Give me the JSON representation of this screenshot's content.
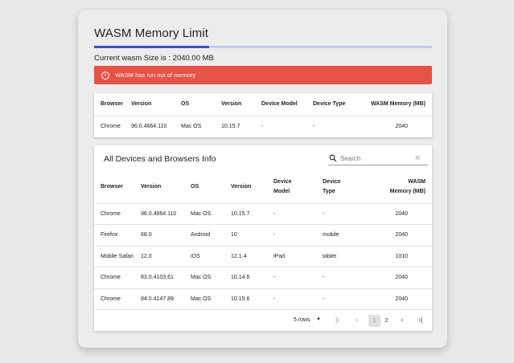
{
  "title": "WASM Memory Limit",
  "progress_fraction": 0.34,
  "current_size": "Current wasm Size is : 2040.00 MB",
  "alert": {
    "text": "WASM has run out of memory",
    "icon": "error-icon"
  },
  "summary_table": {
    "headers": [
      "Browser",
      "Version",
      "OS",
      "Version",
      "Device Model",
      "Device Type",
      "WASM Memory (MB)"
    ],
    "row": [
      "Chrome",
      "96.0.4664.110",
      "Mac OS",
      "10.15.7",
      "-",
      "-",
      "2040"
    ]
  },
  "devices_table": {
    "title": "All Devices and Browsers Info",
    "search_placeholder": "Search",
    "headers": [
      [
        "Browser"
      ],
      [
        "Version"
      ],
      [
        "OS"
      ],
      [
        "Version"
      ],
      [
        "Device",
        "Model"
      ],
      [
        "Device",
        "Type"
      ],
      [
        "WASM",
        "Memory (MB)"
      ]
    ],
    "rows": [
      [
        "Chrome",
        "96.0.4664.110",
        "Mac OS",
        "10.15.7",
        "-",
        "-",
        "2040"
      ],
      [
        "Firefox",
        "68.0",
        "Android",
        "10",
        "-",
        "mobile",
        "2040"
      ],
      [
        "Mobile Safari",
        "12.0",
        "iOS",
        "12.1.4",
        "iPad",
        "tablet",
        "1010"
      ],
      [
        "Chrome",
        "83.0.4103.61",
        "Mac OS",
        "10.14.6",
        "-",
        "-",
        "2040"
      ],
      [
        "Chrome",
        "84.0.4147.89",
        "Mac OS",
        "10.15.6",
        "-",
        "-",
        "2040"
      ]
    ],
    "pagination": {
      "rows_label": "5 rows",
      "pages": [
        "1",
        "2"
      ],
      "current_page": "1"
    }
  }
}
